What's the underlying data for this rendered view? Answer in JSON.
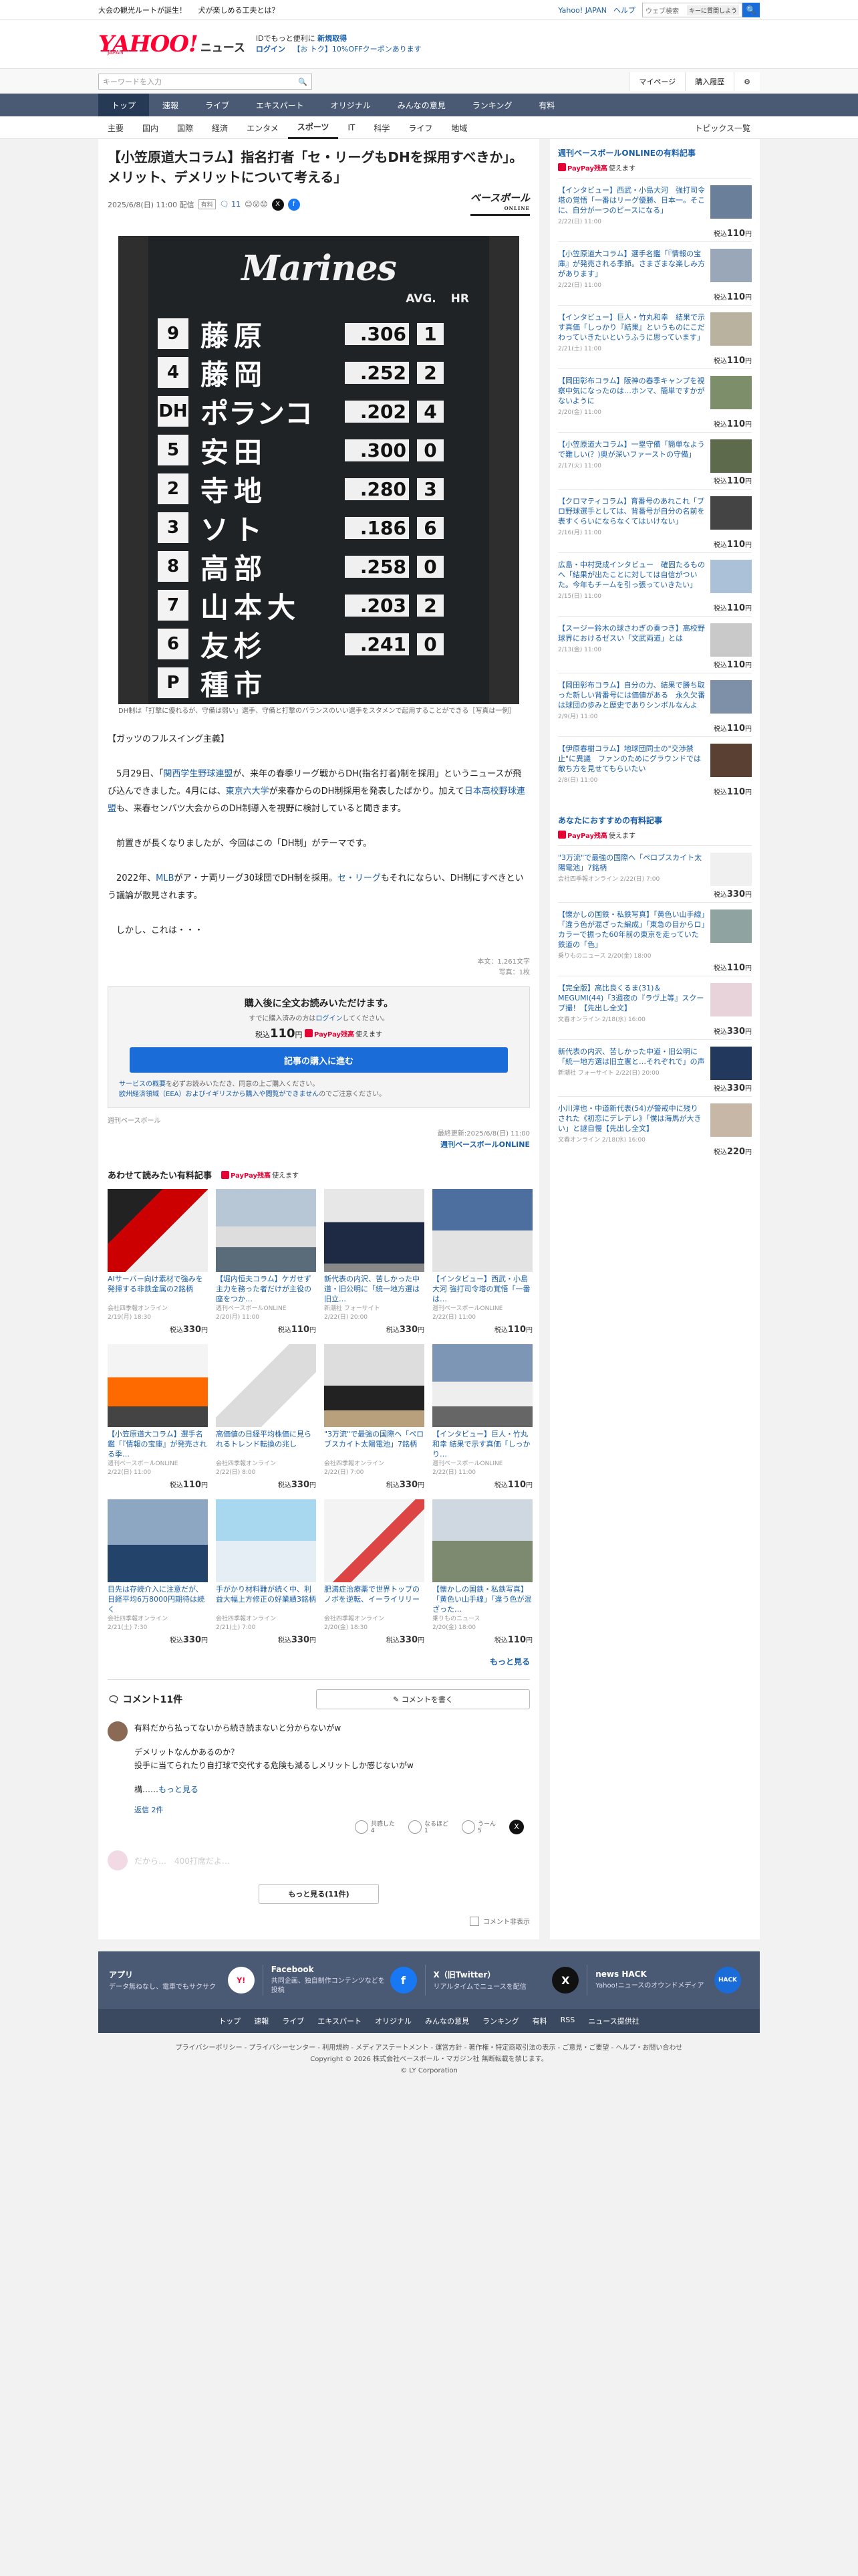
{
  "promo": {
    "left1": "大会の観光ルートが誕生！",
    "left2": "犬が楽しめる工夫とは？",
    "yahoo_japan": "Yahoo! JAPAN",
    "help": "ヘルプ",
    "web_search_placeholder": "ウェブ検索",
    "ai_assist": "キーに質問しよう",
    "search_btn": "🔍"
  },
  "brand": {
    "logo": "YAHOO!",
    "logo_jp": "JAPAN",
    "news": "ニュース",
    "line1_a": "IDでもっと便利に",
    "line1_b": "新規取得",
    "login": "ログイン",
    "coupon": "【お トク】10%OFFクーポンあります"
  },
  "search": {
    "placeholder": "キーワードを入力",
    "mypage": "マイページ",
    "history": "購入履歴"
  },
  "mainnav": [
    "トップ",
    "速報",
    "ライブ",
    "エキスパート",
    "オリジナル",
    "みんなの意見",
    "ランキング",
    "有料"
  ],
  "catnav": [
    "主要",
    "国内",
    "国際",
    "経済",
    "エンタメ",
    "スポーツ",
    "IT",
    "科学",
    "ライフ",
    "地域"
  ],
  "topics": "トピックス一覧",
  "article": {
    "title": "【小笠原道大コラム】指名打者「セ・リーグもDHを採用すべきか」。メリット、デメリットについて考える」",
    "date": "2025/6/8(日) 11:00 配信",
    "pay_badge": "有料",
    "comment_count": "11",
    "publisher": "ベースボール",
    "publisher_sub": "ONLINE",
    "photo": {
      "team": "Marines",
      "header": "AVG. HR",
      "rows": [
        {
          "order": "9",
          "name": "藤原",
          "avg": ".306",
          "hr": "1"
        },
        {
          "order": "4",
          "name": "藤岡",
          "avg": ".252",
          "hr": "2"
        },
        {
          "order": "DH",
          "name": "ポランコ",
          "avg": ".202",
          "hr": "4"
        },
        {
          "order": "5",
          "name": "安田",
          "avg": ".300",
          "hr": "0"
        },
        {
          "order": "2",
          "name": "寺地",
          "avg": ".280",
          "hr": "3"
        },
        {
          "order": "3",
          "name": "ソト",
          "avg": ".186",
          "hr": "6"
        },
        {
          "order": "8",
          "name": "高部",
          "avg": ".258",
          "hr": "0"
        },
        {
          "order": "7",
          "name": "山本大",
          "avg": ".203",
          "hr": "2"
        },
        {
          "order": "6",
          "name": "友杉",
          "avg": ".241",
          "hr": "0"
        },
        {
          "order": "P",
          "name": "種市",
          "avg": "",
          "hr": ""
        }
      ]
    },
    "caption": "DH制は「打撃に優れるが、守備は弱い」選手、守備と打撃のバランスのいい選手をスタメンで起用することができる［写真は一例］",
    "lead": "【ガッツのフルスイング主義】",
    "p1_a": "5月29日、「",
    "p1_link1": "関西学生野球連盟",
    "p1_b": "が、来年の春季リーグ戦からDH(指名打者)制を採用」というニュースが飛び込んできました。4月には、",
    "p1_link2": "東京六大学",
    "p1_c": "が来春からのDH制採用を発表したばかり。加えて",
    "p1_link3": "日本高校野球連盟",
    "p1_d": "も、来春センバツ大会からのDH制導入を視野に検討していると聞きます。",
    "p2": "前置きが長くなりましたが、今回はこの「DH制」がテーマです。",
    "p3_a": "2022年、",
    "p3_link1": "MLB",
    "p3_b": "がア・ナ両リーグ30球団でDH制を採用。",
    "p3_link2": "セ・リーグ",
    "p3_c": "もそれにならい、DH制にすべきという議論が散見されます。",
    "p4": "しかし、これは・・・",
    "chars": "本文：1,261文字",
    "photos": "写真：1枚"
  },
  "buy": {
    "heading": "購入後に全文お読みいただけます。",
    "already_a": "すでに購入済みの方は",
    "already_link": "ログイン",
    "already_b": "してください。",
    "price_prefix": "税込",
    "price": "110",
    "price_unit": "円",
    "paypay": "PayPay残高",
    "paypay_use": "使えます",
    "button": "記事の購入に進む",
    "note1_link": "サービスの概要",
    "note1": "を必ずお読みいただき、同意の上ご購入ください。",
    "note2_link": "欧州経済領域（EEA）およびイギリスから購入や閲覧ができません",
    "note2": "のでご注意ください。"
  },
  "source_name": "週刊ベースボール",
  "updated": "最終更新:2025/6/8(日) 11:00",
  "updated_link": "週刊ベースボールONLINE",
  "related": {
    "heading": "あわせて読みたい有料記事",
    "paypay": "PayPay残高",
    "paypay_use": "使えます",
    "items": [
      {
        "title": "AIサーバー向け素材で強みを発揮する非鉄金属の2銘柄",
        "src": "会社四季報オンライン",
        "date": "2/19(月) 18:30",
        "price": "330"
      },
      {
        "title": "【堀内恒夫コラム】ケガせず主力を務った者だけが主役の座をつか…",
        "src": "週刊ベースボールONLINE",
        "date": "2/20(月) 11:00",
        "price": "110"
      },
      {
        "title": "新代表の内沢、苦しかった中道・旧公明に「統一地方選は旧立…",
        "src": "新潮社 フォーサイト",
        "date": "2/22(日) 20:00",
        "price": "330"
      },
      {
        "title": "【インタビュー】西武・小島大河 強打司令塔の覚悟「一番は…",
        "src": "週刊ベースボールONLINE",
        "date": "2/22(日) 11:00",
        "price": "110"
      },
      {
        "title": "【小笠原道大コラム】選手名鑑「『情報の宝庫』が発売される季…",
        "src": "週刊ベースボールONLINE",
        "date": "2/22(日) 11:00",
        "price": "110"
      },
      {
        "title": "高価値の日経平均株価に見られるトレンド転換の兆し",
        "src": "会社四季報オンライン",
        "date": "2/22(日) 8:00",
        "price": "330"
      },
      {
        "title": "\"3万流\"で最強の国際ヘ「ペロブスカイト太陽電池」7銘柄",
        "src": "会社四季報オンライン",
        "date": "2/22(日) 7:00",
        "price": "330"
      },
      {
        "title": "【インタビュー】巨人・竹丸和幸 結果で示す真価「しっかり…",
        "src": "週刊ベースボールONLINE",
        "date": "2/22(日) 11:00",
        "price": "110"
      },
      {
        "title": "目先は存続介入に注意だが、日経平均6万8000円期待は続く",
        "src": "会社四季報オンライン",
        "date": "2/21(土) 7:30",
        "price": "330"
      },
      {
        "title": "手がかり材料難が続く中、利益大幅上方修正の好業績3銘柄",
        "src": "会社四季報オンライン",
        "date": "2/21(土) 7:00",
        "price": "330"
      },
      {
        "title": "肥満症治療薬で世界トップのノボを逆転、イーライリリー",
        "src": "会社四季報オンライン",
        "date": "2/20(金) 18:30",
        "price": "330"
      },
      {
        "title": "【懐かしの国鉄・私鉄写真】「黄色い山手線」「違う色が混ざった…",
        "src": "乗りものニュース",
        "date": "2/20(金) 18:00",
        "price": "110"
      }
    ],
    "more": "もっと見る"
  },
  "comments": {
    "title": "コメント11件",
    "write": "コメントを書く",
    "c1_l1": "有料だから払ってないから続き読まないと分からないがw",
    "c1_l2": "デメリットなんかあるのか？",
    "c1_l3": "投手に当てられたり自打球で交代する危険も減るしメリットしか感じないがw",
    "c1_l4": "構……",
    "c1_more": "もっと見る",
    "react1": "共感した",
    "react1_n": "4",
    "react2": "なるほど",
    "react2_n": "1",
    "react3": "うーん",
    "react3_n": "5",
    "reply": "返信 2件",
    "c2": "だから…　400打席だよ…",
    "more_btn": "もっと見る(11件)",
    "setting": "コメント非表示"
  },
  "side": {
    "heading": "週刊ベースボールONLINEの有料記事",
    "paypay": "PayPay残高",
    "paypay_use": "使えます",
    "items": [
      {
        "title": "【インタビュー】西武・小島大河　強打司令塔の覚悟「一番はリーグ優勝、日本一。そこに、自分が一つのピースになる」",
        "date": "2/22(日) 11:00",
        "price": "110"
      },
      {
        "title": "【小笠原道大コラム】選手名鑑「『情報の宝庫』が発売される季節。さまざまな楽しみ方があります」",
        "date": "2/22(日) 11:00",
        "price": "110"
      },
      {
        "title": "【インタビュー】巨人・竹丸和幸　結果で示す真価「しっかり『結果』というものにこだわっていきたいというふうに思っています」",
        "date": "2/21(土) 11:00",
        "price": "110"
      },
      {
        "title": "【岡田彰布コラム】阪神の春季キャンプを視察中気になったのは…ホンマ、簡単ですかがないように",
        "date": "2/20(金) 11:00",
        "price": "110"
      },
      {
        "title": "【小笠原道大コラム】一塁守備「簡単なようで難しい(？)奥が深いファーストの守備」",
        "date": "2/17(火) 11:00",
        "price": "110"
      },
      {
        "title": "【クロマティコラム】育番号のあれこれ「プロ野球選手としては、背番号が自分の名前を表すくらいにならなくてはいけない」",
        "date": "2/16(月) 11:00",
        "price": "110"
      },
      {
        "title": "広島・中村奨成インタビュー　確固たるものへ「結果が出たことに対しては自信がついた。今年もチームを引っ張っていきたい」",
        "date": "2/15(日) 11:00",
        "price": "110"
      },
      {
        "title": "【スージー鈴木の球さわぎの奏つき】高校野球界におけるゼスい「文武両道」とは",
        "date": "2/13(金) 11:00",
        "price": "110"
      },
      {
        "title": "【岡田彰布コラム】自分の力、結果で勝ち取った新しい背番号には価値がある　永久欠番は球団の歩みと歴史でありシンボルなんよ",
        "date": "2/9(月) 11:00",
        "price": "110"
      },
      {
        "title": "【伊原春樹コラム】地球団同士の\"交渉禁止\"に異議　ファンのためにグラウンドでは敵ち方を見せてもらいたい",
        "date": "2/8(日) 11:00",
        "price": "110"
      }
    ],
    "heading2": "あなたにおすすめの有料記事",
    "items2": [
      {
        "title": "\"3万流\"で最強の国際ヘ「ペロブスカイト太陽電池」7銘柄",
        "src": "会社四季報オンライン 2/22(日) 7:00",
        "price": "330"
      },
      {
        "title": "【懐かしの国鉄・私鉄写真】「黄色い山手線」「違う色が混ざった編成」「東急の目からロ」カラーで振った60年前の東京を走っていた鉄道の「色」",
        "src": "乗りものニュース 2/20(金) 18:00",
        "price": "110"
      },
      {
        "title": "【完全版】高比良くるま(31)＆MEGUMI(44)「3週夜の『ラヴ上等』スクープ撮！【先出し全文】",
        "src": "文春オンライン 2/18(水) 16:00",
        "price": "330"
      },
      {
        "title": "新代表の内沢、苦しかった中道・旧公明に「統一地方選は旧立憲と…それぞれで」の声",
        "src": "新潮社 フォーサイト 2/22(日) 20:00",
        "price": "330"
      },
      {
        "title": "小川淳也・中道新代表(54)が警戒中に残りされた《初恋にデレデレ》「僕は海馬が大きい」と謎自慢【先出し全文】",
        "src": "文春オンライン 2/18(水) 16:00",
        "price": "220"
      }
    ]
  },
  "footer": {
    "app_h": "アプリ",
    "app_d": "データ無ねなし、電車でもサクサク",
    "fb_h": "Facebook",
    "fb_d": "共同企画、独自制作コンテンツなどを投稿",
    "x_h": "X（旧Twitter）",
    "x_d": "リアルタイムでニュースを配信",
    "hack_h": "news HACK",
    "hack_d": "Yahoo!ニュースのオウンドメディア",
    "links": [
      "トップ",
      "速報",
      "ライブ",
      "エキスパート",
      "オリジナル",
      "みんなの意見",
      "ランキング",
      "有料",
      "RSS",
      "ニュース提供社"
    ],
    "legal": "プライバシーポリシー - プライバシーセンター - 利用規約 - メディアステートメント - 運営方針 - 著作権・特定商取引法の表示 - ご意見・ご要望 - ヘルプ・お問い合わせ",
    "copy1": "Copyright © 2026 株式会社ベースボール・マガジン社 無断転載を禁じます。",
    "copy2": "© LY Corporation"
  }
}
